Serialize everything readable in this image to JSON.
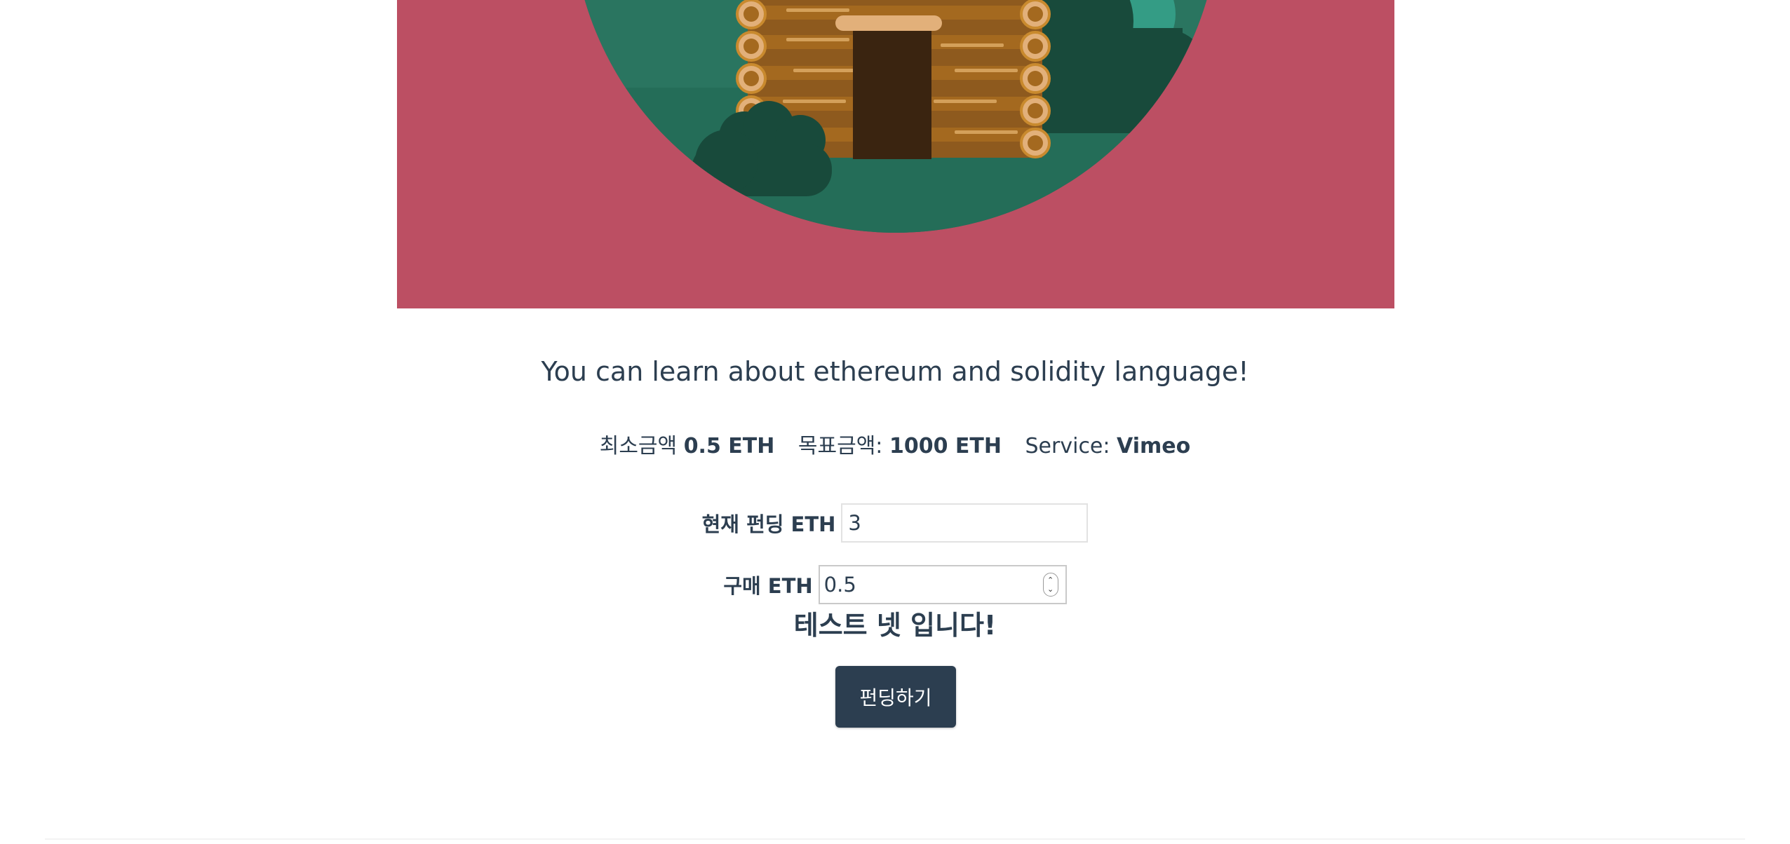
{
  "colors": {
    "hero_background": "#bc4f63",
    "primary_text": "#2c3e50",
    "button_background": "#2c3e50",
    "button_text": "#ffffff"
  },
  "hero": {
    "icon": "log-cabin-illustration"
  },
  "description": "You can learn about ethereum and solidity language!",
  "info": {
    "min_label": "최소금액",
    "min_value": "0.5 ETH",
    "goal_label": "목표금액:",
    "goal_value": "1000 ETH",
    "service_label": "Service:",
    "service_value": "Vimeo"
  },
  "form": {
    "current_label": "현재 펀딩 ETH",
    "current_value": "3",
    "buy_label": "구매 ETH",
    "buy_value": "0.5"
  },
  "notice": "테스트 넷 입니다!",
  "fund_button_label": "펀딩하기"
}
